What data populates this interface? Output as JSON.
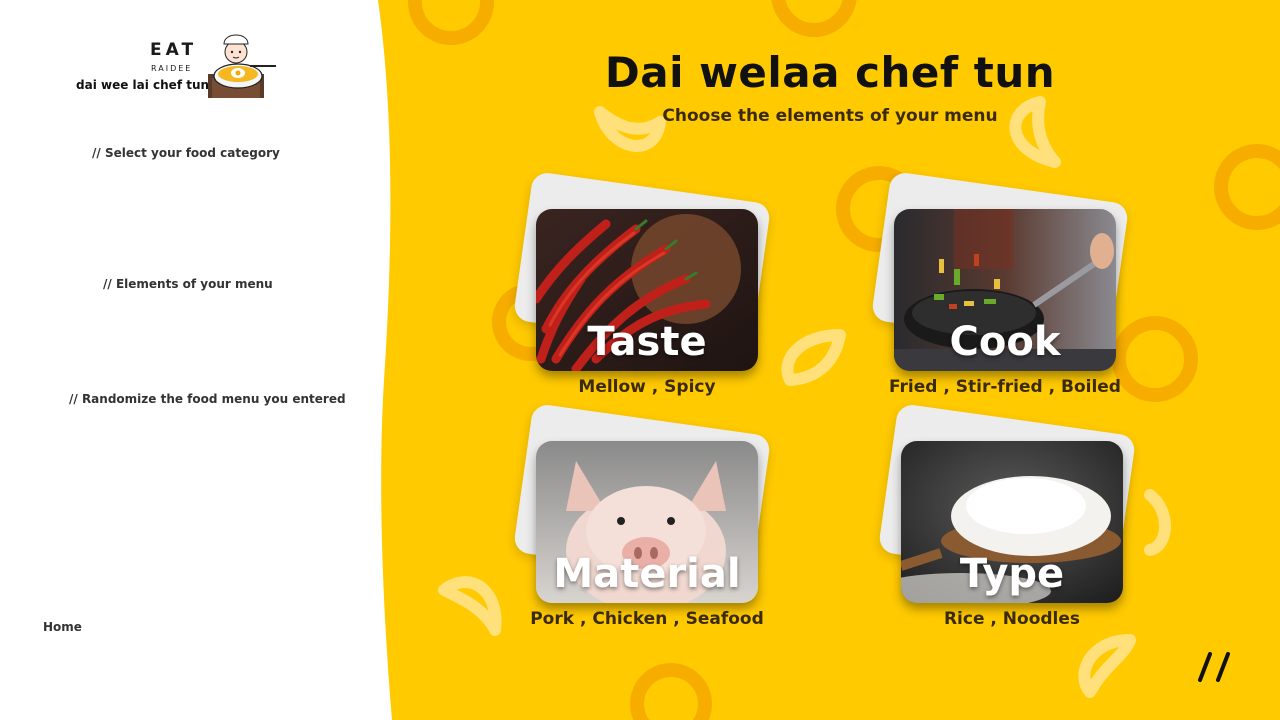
{
  "brand": {
    "eat": "EAT",
    "raidee": "RAIDEE",
    "tagline": "dai wee lai chef tun"
  },
  "sidebar": {
    "category_label": "// Select your food category",
    "elements_label": "// Elements of your menu",
    "randomize_label": "// Randomize the food menu you entered",
    "home_label": "Home"
  },
  "main": {
    "title": "Dai welaa chef tun",
    "subtitle": "Choose the elements of your menu"
  },
  "cards": [
    {
      "name": "Taste",
      "options": "Mellow , Spicy",
      "image": "chili-peppers"
    },
    {
      "name": "Cook",
      "options": "Fried , Stir-fried , Boiled",
      "image": "wok-stir-fry"
    },
    {
      "name": "Material",
      "options": "Pork , Chicken , Seafood",
      "image": "piglet"
    },
    {
      "name": "Type",
      "options": "Rice , Noodles",
      "image": "rice-spoon"
    }
  ],
  "colors": {
    "accent_yellow": "#FFCA00",
    "deco_orange": "#F5A800",
    "deco_light": "#FFE07A",
    "text_dark": "#111111"
  }
}
